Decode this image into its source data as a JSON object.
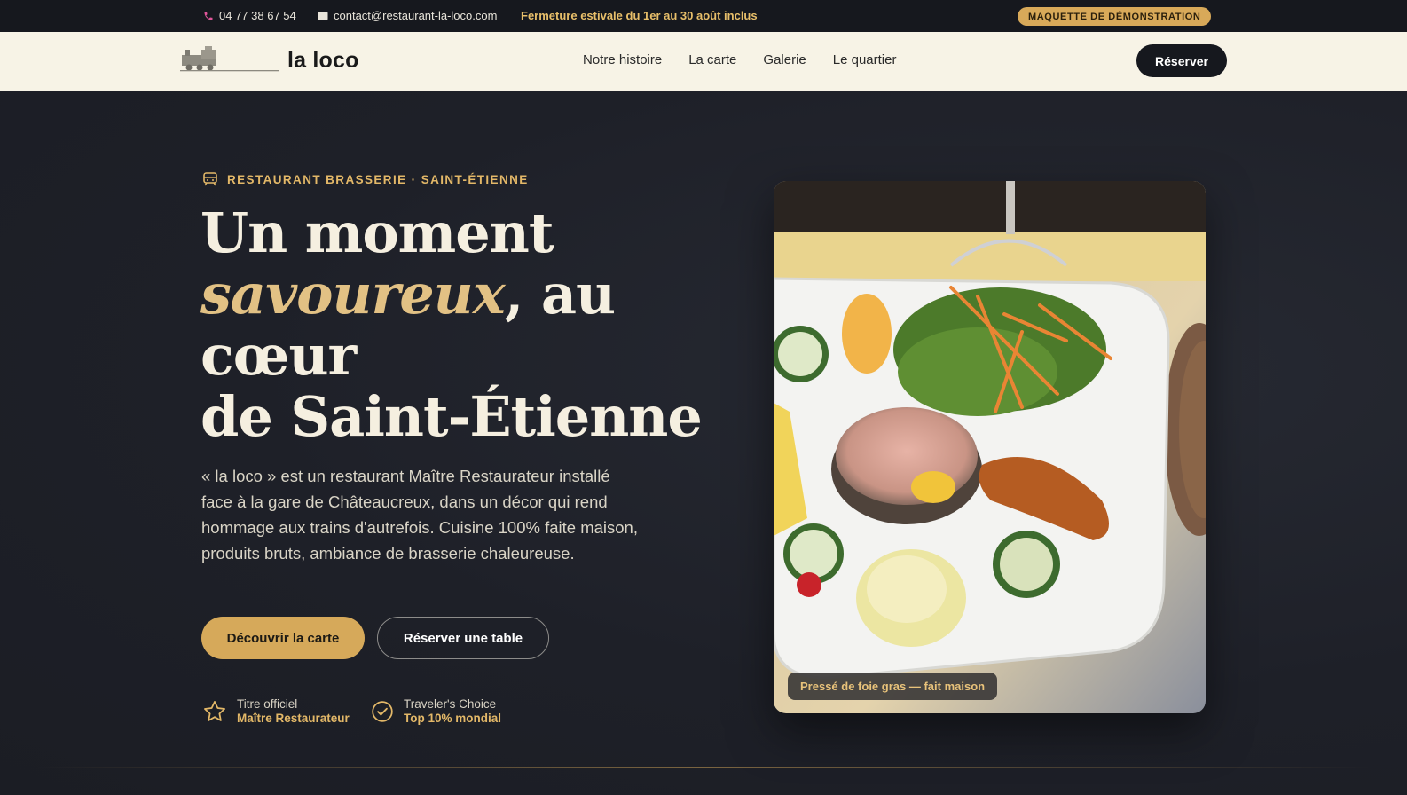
{
  "topbar": {
    "phone": "04 77 38 67 54",
    "email": "contact@restaurant-la-loco.com",
    "notice": "Fermeture estivale du 1er au 30 août inclus",
    "demo_badge": "MAQUETTE DE DÉMONSTRATION"
  },
  "nav": {
    "logo_text": "la loco",
    "links": [
      "Notre histoire",
      "La carte",
      "Galerie",
      "Le quartier"
    ],
    "reserve_label": "Réserver"
  },
  "hero": {
    "eyebrow": "RESTAURANT BRASSERIE · SAINT-ÉTIENNE",
    "headline_1": "Un moment",
    "headline_accent": "savoureux",
    "headline_2": ", au cœur",
    "headline_3": "de Saint-Étienne",
    "lead": "« la loco » est un restaurant Maître Restaurateur installé face à la gare de Châteaucreux, dans un décor qui rend hommage aux trains d'autrefois. Cuisine 100% faite maison, produits bruts, ambiance de brasserie chaleureuse.",
    "primary_cta": "Découvrir la carte",
    "secondary_cta": "Réserver une table",
    "badges": [
      {
        "top": "Titre officiel",
        "bottom": "Maître Restaurateur",
        "icon": "star-icon"
      },
      {
        "top": "Traveler's Choice",
        "bottom": "Top 10% mondial",
        "icon": "check-circle-icon"
      }
    ],
    "image_caption": "Pressé de foie gras — fait maison"
  },
  "colors": {
    "accent": "#d6a95a",
    "dark": "#16181e",
    "cream": "#f7f3e6"
  }
}
